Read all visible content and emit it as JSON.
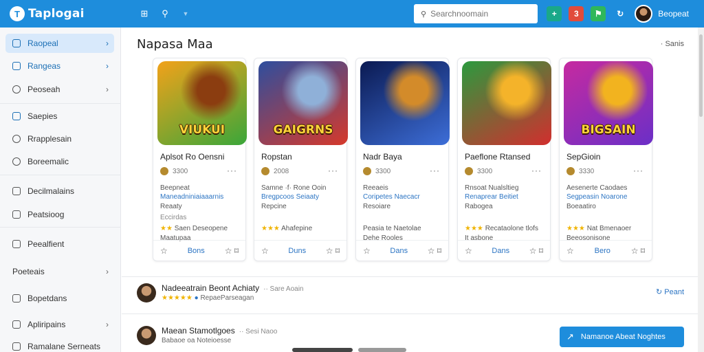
{
  "app": {
    "title": "Taplogai",
    "logo_letter": "T"
  },
  "topbar": {
    "search_placeholder": "Searchnoomain",
    "user_name": "Beopeat",
    "badge": "3"
  },
  "sidebar": {
    "items": [
      {
        "label": "Raopeal"
      },
      {
        "label": "Rangeas"
      },
      {
        "label": "Peoseah"
      },
      {
        "label": "Saepies"
      },
      {
        "label": "Rrapplesain"
      },
      {
        "label": "Boreemalic"
      },
      {
        "label": "Decilmalains"
      },
      {
        "label": "Peatsioog"
      },
      {
        "label": "Peealfient"
      },
      {
        "label": "Poeteais"
      },
      {
        "label": "Bopetdans"
      },
      {
        "label": "Apliripains"
      },
      {
        "label": "Ramalane Serneats"
      }
    ]
  },
  "section": {
    "title": "Napasa Maa",
    "link": "Sanis"
  },
  "cards": [
    {
      "art_label": "VIUKUI",
      "name": "Aplsot Ro Oensni",
      "meta": "3300",
      "l1": "Beepneat",
      "l2": "Maneadniniaiaaarnis",
      "l3": "Reaaty",
      "l4": "Eccirdas",
      "rating_stars": "★★",
      "rating_text": "Saen Deseopene",
      "l5": "Maatupaa",
      "action": "Bons",
      "colors": [
        "#f2a21a",
        "#3aa63a",
        "#8b3d10"
      ]
    },
    {
      "art_label": "GAIGRNS",
      "name": "Ropstan",
      "meta": "2008",
      "l1": "Samne ·f· Rone Ooin",
      "l2": "Bregpcoos Seiaaty",
      "l3": "Repcine",
      "l4": "",
      "rating_stars": "★★★",
      "rating_text": "Ahafepine",
      "l5": "",
      "action": "Duns",
      "colors": [
        "#2e4e9e",
        "#d6392b",
        "#8fb0d8"
      ]
    },
    {
      "art_label": "",
      "name": "Nadr Baya",
      "meta": "3300",
      "l1": "Reeaeis",
      "l2": "Coripetes Naecacr",
      "l3": "Resoiare",
      "l4": "",
      "rating_stars": "",
      "rating_text": "Peasia te Naetolae",
      "l5": "Dehe Rooles",
      "action": "Dans",
      "colors": [
        "#0b1a52",
        "#3d6ed8",
        "#d38b2a"
      ]
    },
    {
      "art_label": "",
      "name": "Paeflone Rtansed",
      "meta": "3300",
      "l1": "Rnsoat Nualsltieg",
      "l2": "Renaprear Beitiet",
      "l3": "Rabogea",
      "l4": "",
      "rating_stars": "★★★",
      "rating_text": "Recataolone tlofs",
      "l5": "It asbone",
      "action": "Dans",
      "colors": [
        "#2b9a3e",
        "#d22e2e",
        "#f4b32a"
      ]
    },
    {
      "art_label": "BIGSAIN",
      "name": "SepGioin",
      "meta": "3330",
      "l1": "Aesenerte Caodaes",
      "l2": "Segpeasin Noarone",
      "l3": "Boeaatiro",
      "l4": "",
      "rating_stars": "★★★",
      "rating_text": "Nat Bmenaoer",
      "l5": "Beeosonisone",
      "action": "Bero",
      "colors": [
        "#c62aa0",
        "#6b2fc7",
        "#f2b31f"
      ]
    }
  ],
  "rows": [
    {
      "name": "Nadeeatrain Beont Achiaty",
      "tag": "·· Sare Aoain",
      "stars": "★★★★★",
      "sub": "RepaeParseagan",
      "action": "Peant"
    },
    {
      "name": "Maean Stamotlgoes",
      "tag": "·· Sesi Naoo",
      "stars": "",
      "sub": "Babaoe oa Noteioesse",
      "action": ""
    }
  ],
  "cta": {
    "label": "Namanoe Abeat   Noghtes"
  }
}
